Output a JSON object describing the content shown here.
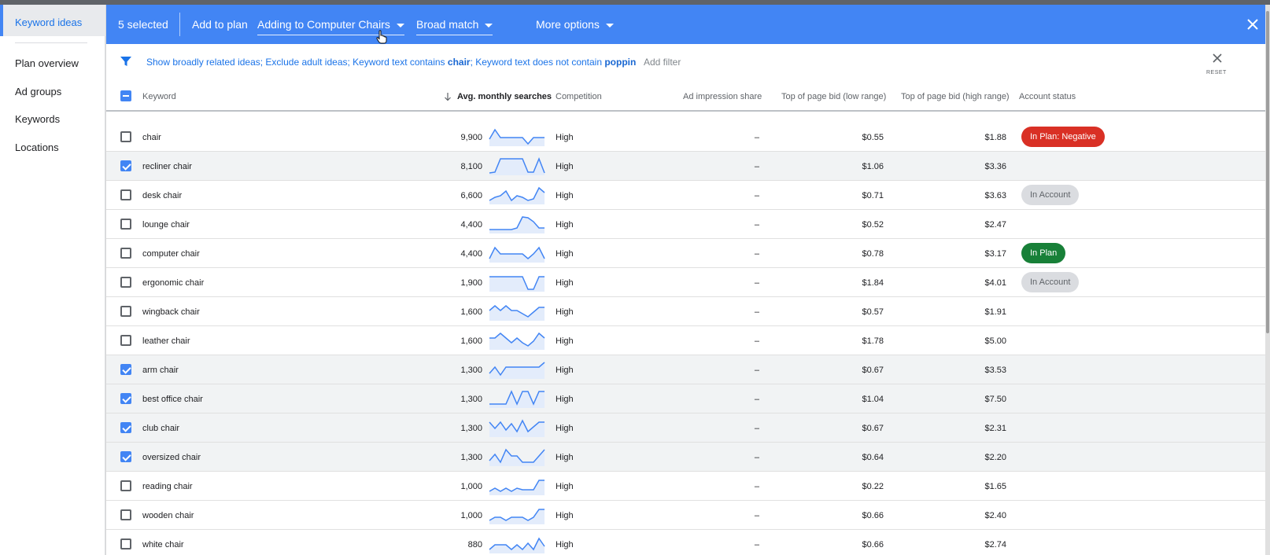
{
  "sidebar": {
    "active": "Keyword ideas",
    "items": [
      "Plan overview",
      "Ad groups",
      "Keywords",
      "Locations"
    ]
  },
  "selection_bar": {
    "selected_text": "5 selected",
    "add_to_plan": "Add to plan",
    "adding_to": "Adding to Computer Chairs",
    "match_type": "Broad match",
    "more_options": "More options"
  },
  "filter": {
    "prefix": "Show broadly related ideas; Exclude adult ideas; Keyword text contains ",
    "contains_word": "chair",
    "middle": "; Keyword text does not contain ",
    "excludes_word": "poppin",
    "add_filter": "Add filter",
    "reset": "RESET"
  },
  "columns": {
    "keyword": "Keyword",
    "searches": "Avg. monthly searches",
    "competition": "Competition",
    "impression_share": "Ad impression share",
    "bid_low": "Top of page bid (low range)",
    "bid_high": "Top of page bid (high range)",
    "account_status": "Account status"
  },
  "colors": {
    "accent": "#4285f4",
    "negative": "#d93025",
    "in_plan": "#188038",
    "in_account": "#dadce0"
  },
  "rows": [
    {
      "keyword": "chair",
      "searches": "9,900",
      "competition": "High",
      "share": "–",
      "low": "$0.55",
      "high": "$1.88",
      "checked": false,
      "status": "In Plan: Negative",
      "status_type": "red",
      "trend": [
        14,
        2,
        12,
        12,
        12,
        12,
        12,
        20,
        12,
        12,
        12
      ]
    },
    {
      "keyword": "recliner chair",
      "searches": "8,100",
      "competition": "High",
      "share": "–",
      "low": "$1.06",
      "high": "$3.36",
      "checked": true,
      "status": "",
      "status_type": "",
      "trend": [
        20,
        19,
        2,
        2,
        2,
        2,
        2,
        19,
        19,
        2,
        20
      ]
    },
    {
      "keyword": "desk chair",
      "searches": "6,600",
      "competition": "High",
      "share": "–",
      "low": "$0.71",
      "high": "$3.63",
      "checked": false,
      "status": "In Account",
      "status_type": "gray",
      "trend": [
        18,
        14,
        12,
        6,
        18,
        12,
        14,
        18,
        16,
        2,
        8
      ]
    },
    {
      "keyword": "lounge chair",
      "searches": "4,400",
      "competition": "High",
      "share": "–",
      "low": "$0.52",
      "high": "$2.47",
      "checked": false,
      "status": "",
      "status_type": "",
      "trend": [
        18,
        18,
        18,
        18,
        18,
        16,
        2,
        3,
        8,
        16,
        16
      ]
    },
    {
      "keyword": "computer chair",
      "searches": "4,400",
      "competition": "High",
      "share": "–",
      "low": "$0.78",
      "high": "$3.17",
      "checked": false,
      "status": "In Plan",
      "status_type": "green",
      "trend": [
        18,
        4,
        12,
        12,
        12,
        12,
        12,
        18,
        12,
        4,
        18
      ]
    },
    {
      "keyword": "ergonomic chair",
      "searches": "1,900",
      "competition": "High",
      "share": "–",
      "low": "$1.84",
      "high": "$4.01",
      "checked": false,
      "status": "In Account",
      "status_type": "gray",
      "trend": [
        4,
        4,
        4,
        4,
        4,
        4,
        4,
        20,
        20,
        4,
        4
      ]
    },
    {
      "keyword": "wingback chair",
      "searches": "1,600",
      "competition": "High",
      "share": "–",
      "low": "$0.57",
      "high": "$1.91",
      "checked": false,
      "status": "",
      "status_type": "",
      "trend": [
        10,
        4,
        10,
        4,
        10,
        10,
        14,
        18,
        12,
        6,
        6
      ]
    },
    {
      "keyword": "leather chair",
      "searches": "1,600",
      "competition": "High",
      "share": "–",
      "low": "$1.78",
      "high": "$5.00",
      "checked": false,
      "status": "",
      "status_type": "",
      "trend": [
        8,
        8,
        2,
        8,
        14,
        8,
        14,
        18,
        12,
        2,
        8
      ]
    },
    {
      "keyword": "arm chair",
      "searches": "1,300",
      "competition": "High",
      "share": "–",
      "low": "$0.67",
      "high": "$3.53",
      "checked": true,
      "status": "",
      "status_type": "",
      "trend": [
        16,
        8,
        18,
        8,
        8,
        8,
        8,
        8,
        8,
        8,
        2
      ]
    },
    {
      "keyword": "best office chair",
      "searches": "1,300",
      "competition": "High",
      "share": "–",
      "low": "$1.04",
      "high": "$7.50",
      "checked": true,
      "status": "",
      "status_type": "",
      "trend": [
        18,
        18,
        18,
        18,
        2,
        18,
        2,
        2,
        18,
        2,
        2
      ]
    },
    {
      "keyword": "club chair",
      "searches": "1,300",
      "competition": "High",
      "share": "–",
      "low": "$0.67",
      "high": "$2.31",
      "checked": true,
      "status": "",
      "status_type": "",
      "trend": [
        4,
        12,
        4,
        14,
        6,
        16,
        2,
        16,
        10,
        4,
        4
      ]
    },
    {
      "keyword": "oversized chair",
      "searches": "1,300",
      "competition": "High",
      "share": "–",
      "low": "$0.64",
      "high": "$2.20",
      "checked": true,
      "status": "",
      "status_type": "",
      "trend": [
        16,
        8,
        18,
        2,
        10,
        10,
        18,
        18,
        18,
        10,
        2
      ]
    },
    {
      "keyword": "reading chair",
      "searches": "1,000",
      "competition": "High",
      "share": "–",
      "low": "$0.22",
      "high": "$1.65",
      "checked": false,
      "status": "",
      "status_type": "",
      "trend": [
        18,
        14,
        18,
        14,
        18,
        14,
        16,
        16,
        16,
        4,
        4
      ]
    },
    {
      "keyword": "wooden chair",
      "searches": "1,000",
      "competition": "High",
      "share": "–",
      "low": "$0.66",
      "high": "$2.40",
      "checked": false,
      "status": "",
      "status_type": "",
      "trend": [
        18,
        14,
        14,
        18,
        14,
        14,
        14,
        18,
        14,
        4,
        4
      ]
    },
    {
      "keyword": "white chair",
      "searches": "880",
      "competition": "High",
      "share": "–",
      "low": "$0.66",
      "high": "$2.74",
      "checked": false,
      "status": "",
      "status_type": "",
      "trend": [
        18,
        12,
        12,
        12,
        18,
        12,
        18,
        10,
        18,
        4,
        14
      ]
    }
  ]
}
